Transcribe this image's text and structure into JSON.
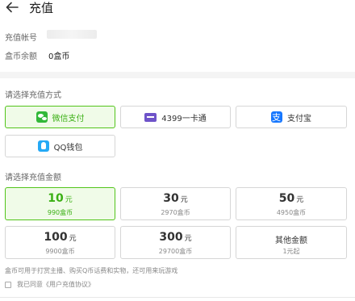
{
  "header": {
    "title": "充值"
  },
  "account": {
    "label": "充值帐号",
    "value": ""
  },
  "balance": {
    "label": "盒币余额",
    "value": "0盒币"
  },
  "payment": {
    "label": "请选择充值方式",
    "methods": [
      {
        "label": "微信支付",
        "icon": "wechat-icon",
        "selected": true
      },
      {
        "label": "4399一卡通",
        "icon": "card-icon",
        "selected": false
      },
      {
        "label": "支付宝",
        "icon": "alipay-icon",
        "selected": false
      },
      {
        "label": "QQ钱包",
        "icon": "qq-wallet-icon",
        "selected": false
      }
    ]
  },
  "amount": {
    "label": "请选择充值金额",
    "unit": "元",
    "options": [
      {
        "value": "10",
        "coins": "990盒币",
        "selected": true
      },
      {
        "value": "30",
        "coins": "2970盒币",
        "selected": false
      },
      {
        "value": "50",
        "coins": "4950盒币",
        "selected": false
      },
      {
        "value": "100",
        "coins": "9900盒币",
        "selected": false
      },
      {
        "value": "300",
        "coins": "29700盒币",
        "selected": false
      },
      {
        "value": "其他金额",
        "coins": "1元起",
        "selected": false
      }
    ]
  },
  "note": "盒币可用于打赏主播、购买Q币话费和实物，还可用来玩游戏",
  "agreement": "我已同意《用户充值协议》",
  "colors": {
    "accent": "#52c41a",
    "accent_bg": "#f0fbe8",
    "wechat": "#32b839",
    "alipay": "#1677ff",
    "card": "#6e53c9",
    "qq": "#25a9f5"
  }
}
